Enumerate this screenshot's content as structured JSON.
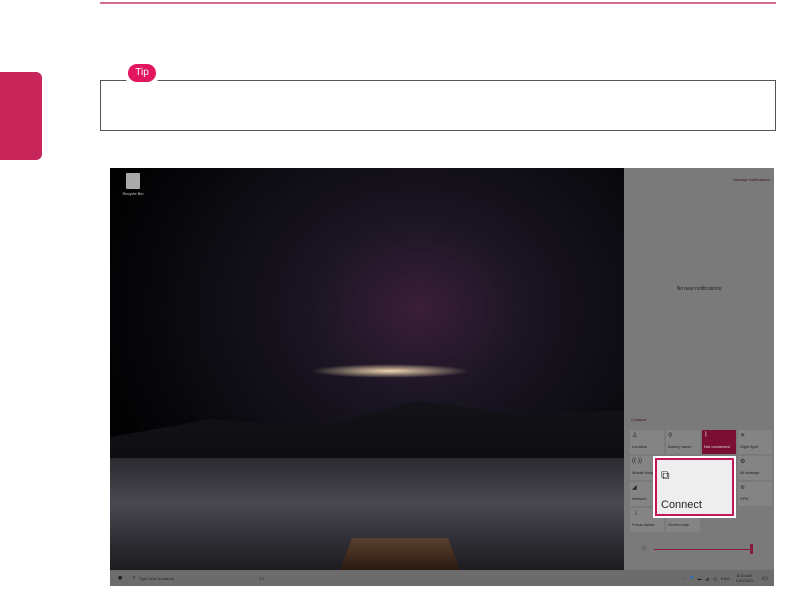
{
  "tip": {
    "label": "Tip"
  },
  "desktop": {
    "recycle_bin": "Recycle Bin"
  },
  "action_center": {
    "manage_notifications": "Manage notifications",
    "no_notifications": "No new notifications",
    "collapse": "Collapse",
    "tiles": [
      {
        "label": "Location",
        "icon": "location-icon",
        "glyph": "♙",
        "active": false
      },
      {
        "label": "Battery saver",
        "icon": "battery-saver-icon",
        "glyph": "⚲",
        "active": false
      },
      {
        "label": "Not connected",
        "icon": "bluetooth-icon",
        "glyph": "ᛒ",
        "active": true
      },
      {
        "label": "Night light",
        "icon": "night-light-icon",
        "glyph": "☀",
        "active": false
      },
      {
        "label": "Mobile hotspot",
        "icon": "hotspot-icon",
        "glyph": "((·))",
        "active": false
      },
      {
        "label": "",
        "icon": "",
        "glyph": "",
        "active": false
      },
      {
        "label": "",
        "icon": "",
        "glyph": "",
        "active": false
      },
      {
        "label": "All settings",
        "icon": "settings-icon",
        "glyph": "⚙",
        "active": false
      },
      {
        "label": "Network",
        "icon": "network-icon",
        "glyph": "◢",
        "active": false
      },
      {
        "label": "",
        "icon": "",
        "glyph": "",
        "active": false
      },
      {
        "label": "",
        "icon": "",
        "glyph": "",
        "active": false
      },
      {
        "label": "VPN",
        "icon": "vpn-icon",
        "glyph": "≋",
        "active": false
      },
      {
        "label": "Focus assist",
        "icon": "focus-assist-icon",
        "glyph": "☽",
        "active": false
      },
      {
        "label": "Screen snip",
        "icon": "screen-snip-icon",
        "glyph": "✂",
        "active": false
      }
    ],
    "brightness_percent": 100
  },
  "connect_popup": {
    "label": "Connect"
  },
  "taskbar": {
    "search_placeholder": "Type here to search",
    "language": "ENG",
    "time": "8:34 AM",
    "date": "1/20/2021"
  },
  "colors": {
    "accent": "#c2185b",
    "tip": "#e2165e"
  }
}
